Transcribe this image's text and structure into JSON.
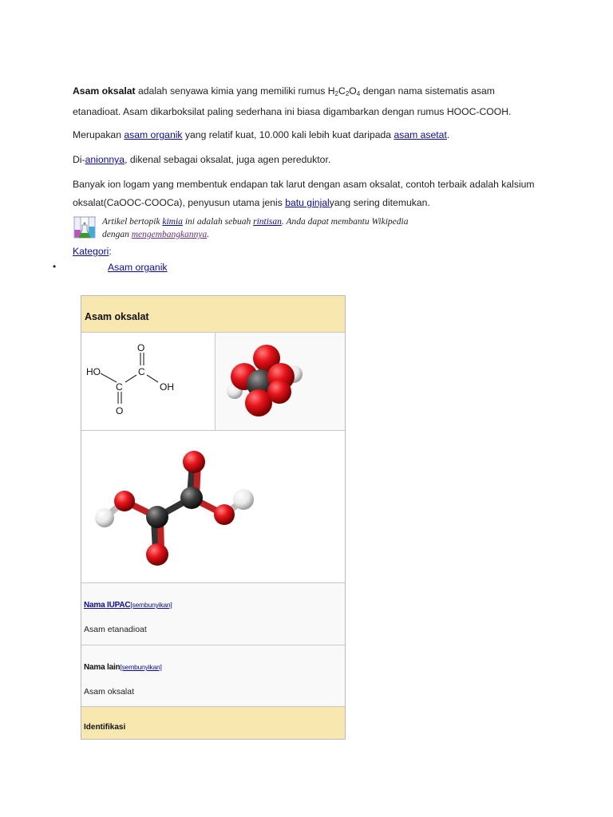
{
  "article": {
    "p1": {
      "bold": "Asam oksalat",
      "t1": " adalah senyawa kimia yang memiliki rumus H",
      "sub1": "2",
      "t2": "C",
      "sub2": "2",
      "t3": "O",
      "sub3": "4",
      "t4": " dengan nama sistematis asam etanadioat. Asam dikarboksilat paling sederhana ini biasa digambarkan dengan rumus HOOC-COOH."
    },
    "p2": {
      "t1": "Merupakan ",
      "link1": "asam organik",
      "t2": " yang relatif kuat, 10.000 kali lebih kuat daripada ",
      "link2": "asam asetat",
      "t3": "."
    },
    "p3": {
      "t1": "Di-",
      "link1": "anionnya",
      "t2": ", dikenal sebagai oksalat, juga agen pereduktor."
    },
    "p4": {
      "t1": "Banyak ion logam yang membentuk endapan tak larut dengan asam oksalat, contoh terbaik adalah kalsium oksalat(CaOOC-COOCa), penyusun utama jenis ",
      "link1": "batu ginjal",
      "t2": "yang sering ditemukan."
    }
  },
  "stub": {
    "icon": "chemistry-flask-icon",
    "t1": "Artikel bertopik ",
    "link1": "kimia",
    "t2": " ini adalah sebuah ",
    "link2": "rintisan",
    "t3": ". Anda dapat membantu Wikipedia",
    "t4": "dengan ",
    "link3": "mengembangkannya",
    "t5": "."
  },
  "categories": {
    "label": "Kategori",
    "colon": ":",
    "bullet": "•",
    "item": "Asam organik"
  },
  "infobox": {
    "title": "Asam oksalat",
    "structure": {
      "o_top": "O",
      "ho": "HO",
      "c1": "C",
      "c2": "C",
      "oh": "OH",
      "o_bottom": "O"
    },
    "iupac_label": "Nama IUPAC",
    "iupac_toggle": "[sembunyikan]",
    "iupac_value": "Asam etanadioat",
    "other_label": "Nama lain",
    "other_toggle": "[sembunyikan]",
    "other_value": "Asam oksalat",
    "ident_label": "Identifikasi"
  },
  "colors": {
    "link": "#0b0b9e",
    "header_bg": "#f8e8b0",
    "oxygen": "#e8141b",
    "carbon": "#444444",
    "hydrogen": "#f2f2f2"
  }
}
